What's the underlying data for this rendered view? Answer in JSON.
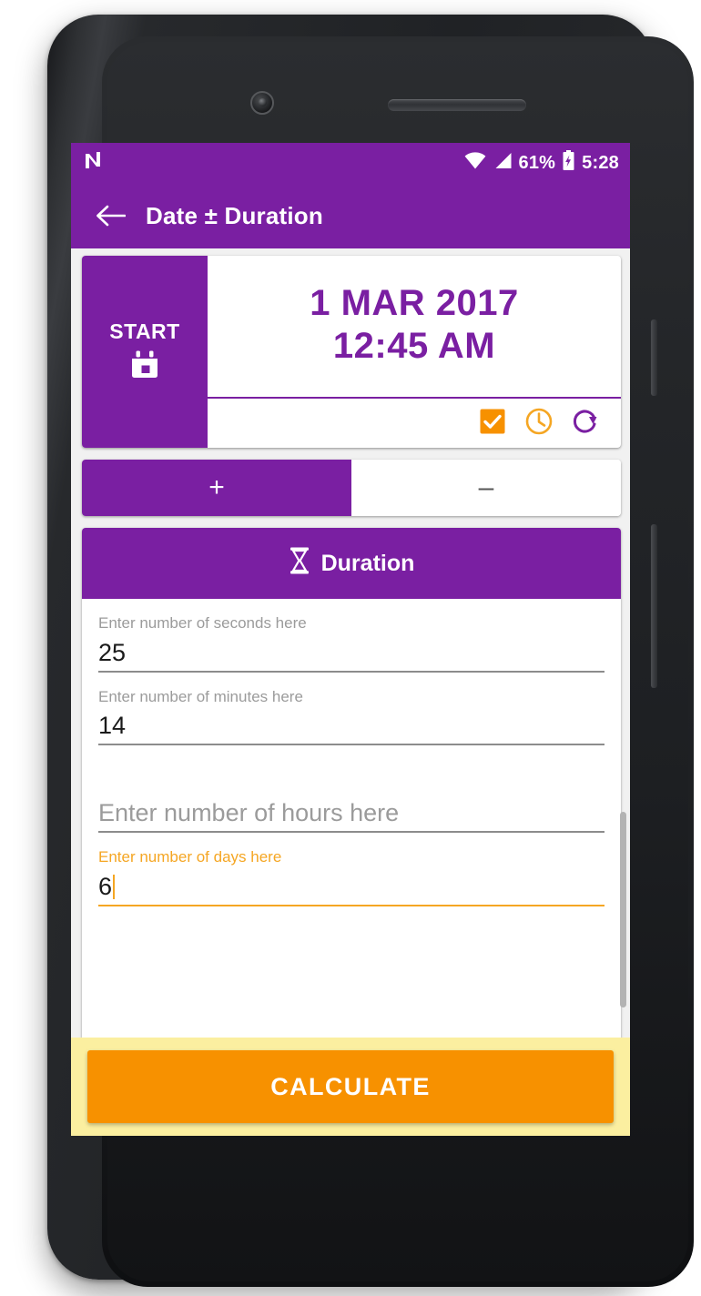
{
  "status_bar": {
    "notification_icon": "android-n-logo-icon",
    "wifi_icon": "wifi-icon",
    "signal_icon": "cell-signal-icon",
    "battery_percent": "61%",
    "battery_icon": "battery-charging-icon",
    "clock": "5:28"
  },
  "app_bar": {
    "back_icon": "back-arrow-icon",
    "title": "Date ± Duration"
  },
  "date_card": {
    "start_label": "START",
    "calendar_icon": "calendar-icon",
    "date_value": "1 MAR 2017",
    "time_value": "12:45 AM",
    "actions": [
      {
        "name": "checkbox-checked-icon",
        "label": "checkbox-checked-icon"
      },
      {
        "name": "clock-icon",
        "label": "clock-icon"
      },
      {
        "name": "reset-rotate-icon",
        "label": "reset-rotate-icon"
      }
    ]
  },
  "sign_toggle": {
    "plus_label": "+",
    "minus_label": "–",
    "selected": "plus"
  },
  "duration_card": {
    "header_icon": "hourglass-icon",
    "header_title": "Duration",
    "fields": [
      {
        "label": "Enter number of seconds here",
        "value": "25",
        "focused": false,
        "empty": false
      },
      {
        "label": "Enter number of minutes here",
        "value": "14",
        "focused": false,
        "empty": false
      },
      {
        "label": "Enter number of hours here",
        "value": "Enter number of hours here",
        "focused": false,
        "empty": true
      },
      {
        "label": "Enter number of days here",
        "value": "6",
        "focused": true,
        "empty": false
      }
    ]
  },
  "calculate": {
    "label": "CALCULATE"
  },
  "colors": {
    "primary_purple": "#7A1FA2",
    "accent_orange": "#F79100",
    "highlight_yellow": "#FBEFA0",
    "focus_orange": "#F5A623"
  }
}
